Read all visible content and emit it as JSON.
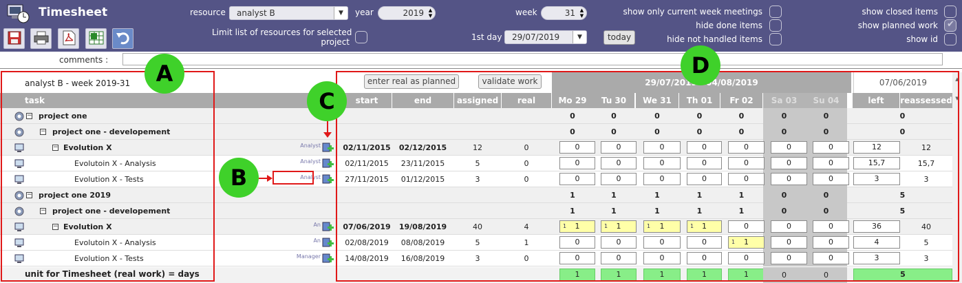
{
  "app": {
    "title": "Timesheet"
  },
  "toolbar": {
    "resource_label": "resource",
    "resource_value": "analyst B",
    "year_label": "year",
    "year_value": "2019",
    "week_label": "week",
    "week_value": "31",
    "first_day_label": "1st day",
    "first_day_value": "29/07/2019",
    "today_label": "today",
    "limit_label_1": "Limit list of resources for selected",
    "limit_label_2": "project",
    "opt_current_week": "show only current week meetings",
    "opt_hide_done": "hide done items",
    "opt_hide_not_handled": "hide not handled items",
    "opt_show_closed": "show closed items",
    "opt_show_planned": "show planned work",
    "opt_show_id": "show id",
    "icons": [
      "save-icon",
      "print-icon",
      "pdf-icon",
      "excel-icon",
      "undo-icon"
    ]
  },
  "comments": {
    "label": "comments :",
    "value": ""
  },
  "grid": {
    "resource_week": "analyst B - week 2019-31",
    "enter_real_label": "enter real as planned",
    "validate_label": "validate work",
    "period_label": "29/07/2019 - 04/08/2019",
    "left_date": "07/06/2019",
    "headers": {
      "task": "task",
      "start": "start",
      "end": "end",
      "assigned": "assigned",
      "real": "real",
      "left": "left",
      "reassessed": "reassessed"
    },
    "days": [
      "Mo 29",
      "Tu 30",
      "We 31",
      "Th 01",
      "Fr 02",
      "Sa 03",
      "Su 04"
    ],
    "rows": [
      {
        "type": "project",
        "name": "project one",
        "start": "",
        "end": "",
        "assigned": "",
        "real": "",
        "days": [
          "0",
          "0",
          "0",
          "0",
          "0",
          "0",
          "0"
        ],
        "left": "0",
        "reassessed": ""
      },
      {
        "type": "project",
        "name": "project one - developement",
        "start": "",
        "end": "",
        "assigned": "",
        "real": "",
        "days": [
          "0",
          "0",
          "0",
          "0",
          "0",
          "0",
          "0"
        ],
        "left": "0",
        "reassessed": ""
      },
      {
        "type": "activity",
        "name": "Evolution X",
        "role": "Analyst",
        "start": "02/11/2015",
        "end": "02/12/2015",
        "assigned": "12",
        "real": "0",
        "days": [
          "0",
          "0",
          "0",
          "0",
          "0",
          "0",
          "0"
        ],
        "left": "12",
        "reassessed": "12"
      },
      {
        "type": "task",
        "name": "Evolutoin X - Analysis",
        "role": "Analyst",
        "start": "02/11/2015",
        "end": "23/11/2015",
        "assigned": "5",
        "real": "0",
        "days": [
          "0",
          "0",
          "0",
          "0",
          "0",
          "0",
          "0"
        ],
        "left": "15,7",
        "reassessed": "15,7"
      },
      {
        "type": "task",
        "name": "Evolution X - Tests",
        "role": "Analyst",
        "start": "27/11/2015",
        "end": "01/12/2015",
        "assigned": "3",
        "real": "0",
        "days": [
          "0",
          "0",
          "0",
          "0",
          "0",
          "0",
          "0"
        ],
        "left": "3",
        "reassessed": "3"
      },
      {
        "type": "project",
        "name": "project one 2019",
        "start": "",
        "end": "",
        "assigned": "",
        "real": "",
        "days": [
          "1",
          "1",
          "1",
          "1",
          "1",
          "0",
          "0"
        ],
        "left": "5",
        "reassessed": ""
      },
      {
        "type": "project",
        "name": "project one - developement",
        "start": "",
        "end": "",
        "assigned": "",
        "real": "",
        "days": [
          "1",
          "1",
          "1",
          "1",
          "1",
          "0",
          "0"
        ],
        "left": "5",
        "reassessed": ""
      },
      {
        "type": "activity",
        "name": "Evolution X",
        "role": "An",
        "start": "07/06/2019",
        "end": "19/08/2019",
        "assigned": "40",
        "real": "4",
        "days": [
          "1",
          "1",
          "1",
          "1",
          "0",
          "0",
          "0"
        ],
        "planned": [
          "1",
          "1",
          "1",
          "1",
          "",
          "",
          ""
        ],
        "left": "36",
        "reassessed": "40"
      },
      {
        "type": "task",
        "name": "Evolutoin X - Analysis",
        "role": "An",
        "start": "02/08/2019",
        "end": "08/08/2019",
        "assigned": "5",
        "real": "1",
        "days": [
          "0",
          "0",
          "0",
          "0",
          "1",
          "0",
          "0"
        ],
        "planned": [
          "",
          "",
          "",
          "",
          "1",
          "",
          ""
        ],
        "left": "4",
        "reassessed": "5"
      },
      {
        "type": "task",
        "name": "Evolution X - Tests",
        "role": "Manager",
        "start": "14/08/2019",
        "end": "16/08/2019",
        "assigned": "3",
        "real": "0",
        "days": [
          "0",
          "0",
          "0",
          "0",
          "0",
          "0",
          "0"
        ],
        "left": "3",
        "reassessed": "3"
      }
    ],
    "footer": {
      "label": "unit for Timesheet (real work) = days",
      "days": [
        "1",
        "1",
        "1",
        "1",
        "1",
        "0",
        "0"
      ],
      "left": "5"
    }
  },
  "annotations": {
    "A": "A",
    "B": "B",
    "C": "C",
    "D": "D"
  },
  "colors": {
    "header_bg": "#545486",
    "grid_header": "#aaaaaa",
    "highlight": "#e01818",
    "badge": "#3fd12a"
  }
}
